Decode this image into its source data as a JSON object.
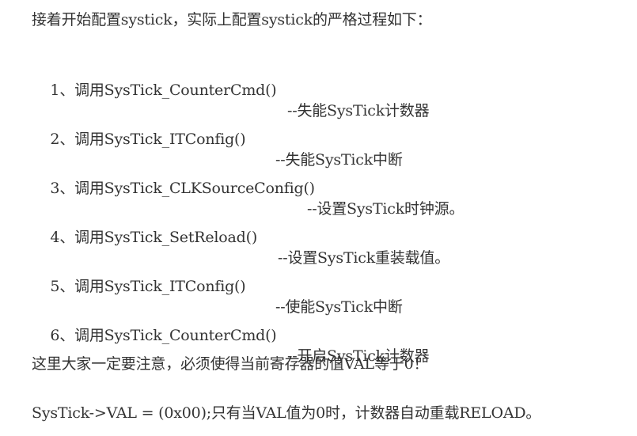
{
  "intro": "接着开始配置systick，实际上配置systick的严格过程如下：",
  "steps": [
    {
      "num": "1、",
      "call": "调用SysTick_CounterCmd()",
      "desc": "--失能SysTick计数器"
    },
    {
      "num": "2、",
      "call": "调用SysTick_ITConfig()",
      "desc": "--失能SysTick中断"
    },
    {
      "num": "3、",
      "call": "调用SysTick_CLKSourceConfig()",
      "desc": "--设置SysTick时钟源。"
    },
    {
      "num": "4、",
      "call": "调用SysTick_SetReload()",
      "desc": "--设置SysTick重装载值。"
    },
    {
      "num": "5、",
      "call": "调用SysTick_ITConfig()",
      "desc": "--使能SysTick中断"
    },
    {
      "num": "6、",
      "call": "调用SysTick_CounterCmd()",
      "desc": "--开启SysTick计数器"
    }
  ],
  "note": "这里大家一定要注意，必须使得当前寄存器的值VAL等于0！",
  "code_line": "SysTick->VAL = (0x00);只有当VAL值为0时，计数器自动重载RELOAD。"
}
